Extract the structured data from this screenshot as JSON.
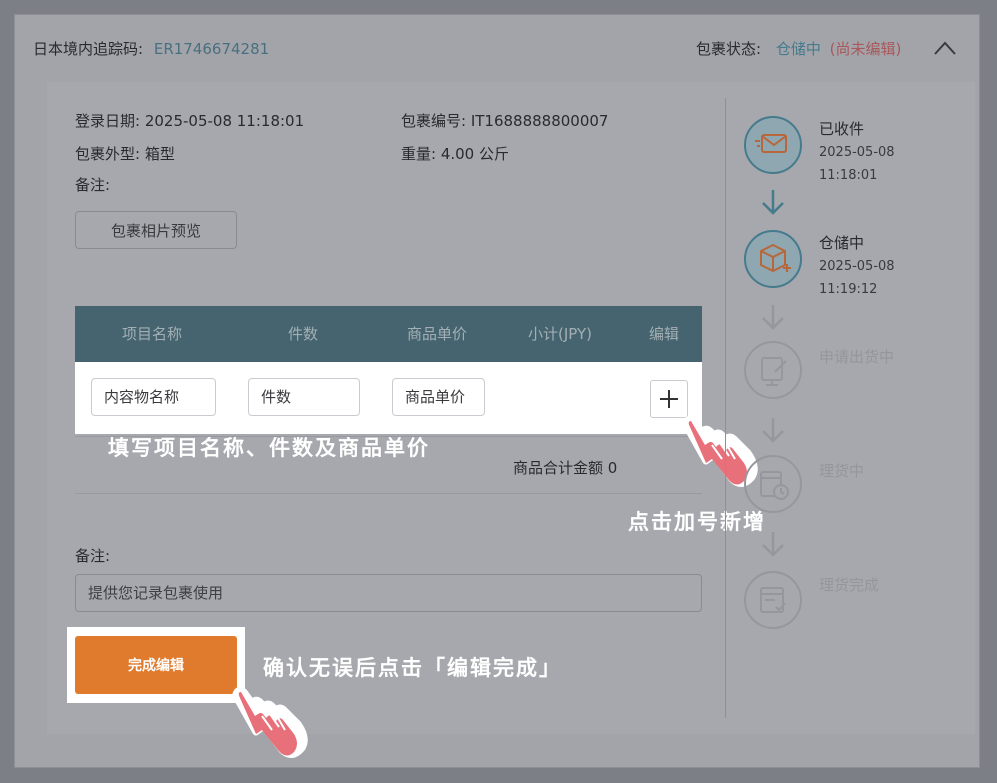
{
  "header": {
    "tracking_label": "日本境内追踪码:",
    "tracking_code": "ER1746674281",
    "status_label": "包裹状态:",
    "status_value": "仓储中",
    "status_note": "(尚未编辑)"
  },
  "info": {
    "login_date": "登录日期:  2025-05-08 11:18:01",
    "package_no": "包裹编号:  IT1688888800007",
    "appearance": "包裹外型:  箱型",
    "weight": "重量:  4.00 公斤",
    "remark": "备注:",
    "photo_btn": "包裹相片预览"
  },
  "table": {
    "headers": [
      "项目名称",
      "件数",
      "商品单价",
      "小计(JPY)",
      "编辑"
    ],
    "placeholders": {
      "name": "内容物名称",
      "qty": "件数",
      "price": "商品单价"
    },
    "total": "商品合计金额 0"
  },
  "annotations": {
    "fill": "填写项目名称、件数及商品单价",
    "add": "点击加号新增",
    "confirm": "确认无误后点击「编辑完成」"
  },
  "remark": {
    "label": "备注:",
    "placeholder": "提供您记录包裹使用"
  },
  "done_btn": "完成编辑",
  "timeline": [
    {
      "title": "已收件",
      "date": "2025-05-08",
      "time": "11:18:01",
      "icon": "mail-icon"
    },
    {
      "title": "仓储中",
      "date": "2025-05-08",
      "time": "11:19:12",
      "icon": "box-icon"
    },
    {
      "title": "申请出货中",
      "icon": "form-icon"
    },
    {
      "title": "理货中",
      "icon": "clock-doc-icon"
    },
    {
      "title": "理货完成",
      "icon": "check-doc-icon"
    }
  ],
  "colors": {
    "accent": "#e07a2d",
    "teal": "#46646f",
    "blue": "#457b8c",
    "red": "#a8585a"
  }
}
